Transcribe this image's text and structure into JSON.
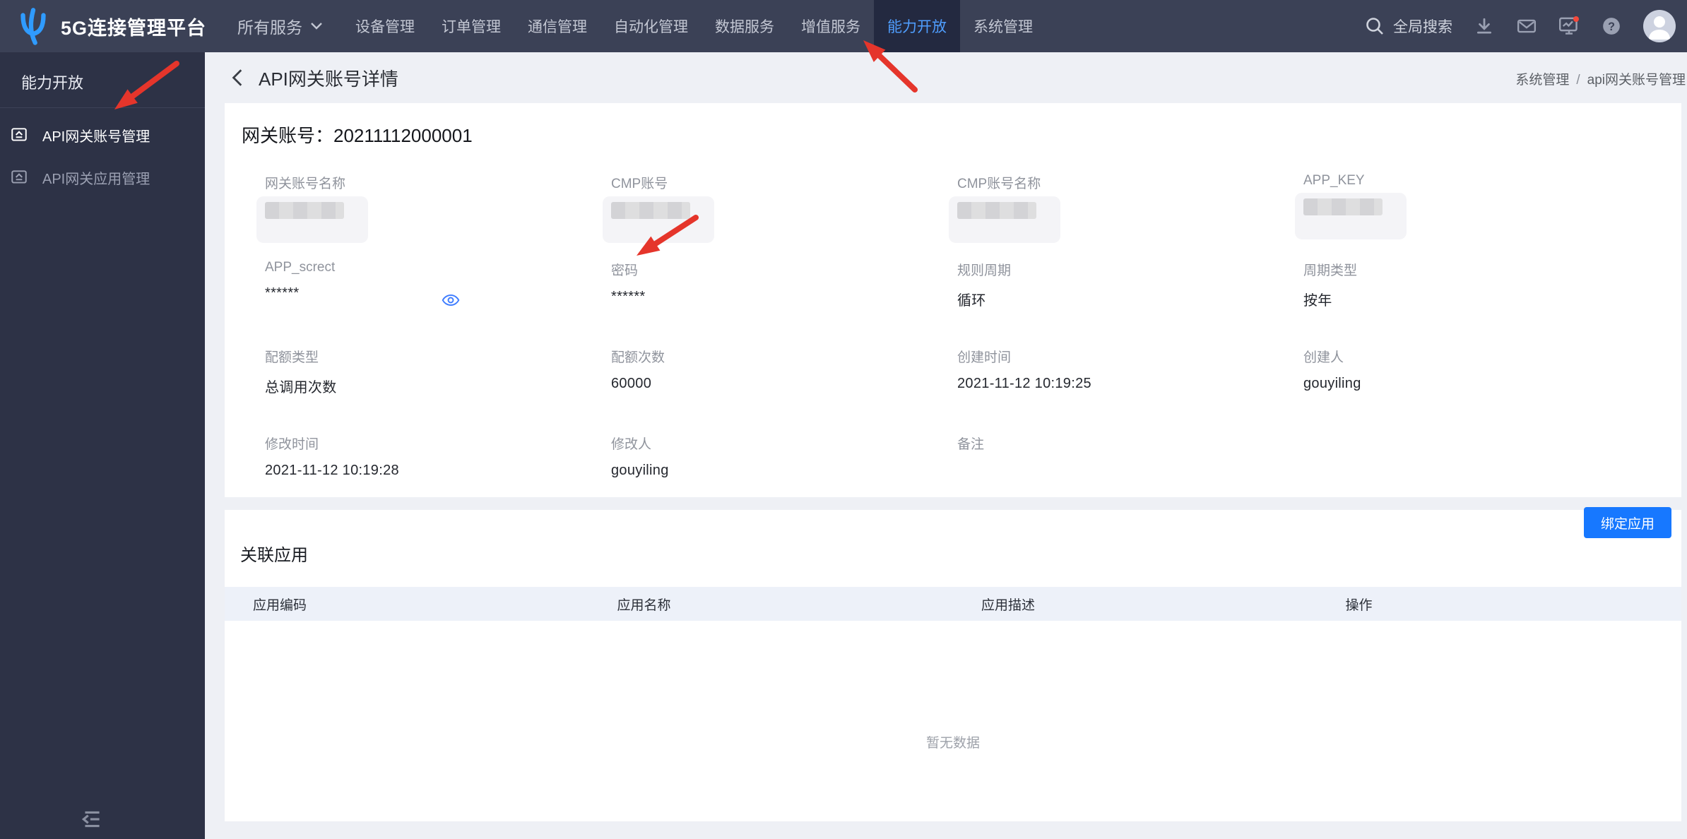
{
  "navbar": {
    "brand": "5G连接管理平台",
    "services_menu_label": "所有服务",
    "items": [
      "设备管理",
      "订单管理",
      "通信管理",
      "自动化管理",
      "数据服务",
      "增值服务",
      "能力开放",
      "系统管理"
    ],
    "active_index": 6,
    "search_label": "全局搜索",
    "right_icons": [
      "search-icon",
      "download-icon",
      "mail-icon",
      "monitor-icon",
      "help-icon",
      "user-avatar"
    ],
    "monitor_badge": true
  },
  "sidebar": {
    "title": "能力开放",
    "items": [
      {
        "label": "API网关账号管理",
        "active": true
      },
      {
        "label": "API网关应用管理",
        "active": false
      }
    ]
  },
  "page_header": {
    "title": "API网关账号详情",
    "breadcrumb": [
      "系统管理",
      "api网关账号管理"
    ],
    "breadcrumb_separator": "/"
  },
  "detail_card": {
    "title_label": "网关账号：",
    "account_id": "20211112000001",
    "fields": [
      {
        "label": "网关账号名称",
        "value": "",
        "redacted": true
      },
      {
        "label": "CMP账号",
        "value": "",
        "redacted": true
      },
      {
        "label": "CMP账号名称",
        "value": "",
        "redacted": true
      },
      {
        "label": "APP_KEY",
        "value": "",
        "redacted": true
      },
      {
        "label": "APP_screct",
        "value": "******",
        "eye": true
      },
      {
        "label": "密码",
        "value": "******"
      },
      {
        "label": "规则周期",
        "value": "循环"
      },
      {
        "label": "周期类型",
        "value": "按年"
      },
      {
        "label": "配额类型",
        "value": "总调用次数"
      },
      {
        "label": "配额次数",
        "value": "60000"
      },
      {
        "label": "创建时间",
        "value": "2021-11-12 10:19:25"
      },
      {
        "label": "创建人",
        "value": "gouyiling"
      },
      {
        "label": "修改时间",
        "value": "2021-11-12 10:19:28"
      },
      {
        "label": "修改人",
        "value": "gouyiling"
      },
      {
        "label": "备注",
        "value": ""
      }
    ]
  },
  "related_apps": {
    "title": "关联应用",
    "bind_button_label": "绑定应用",
    "columns": [
      "应用编码",
      "应用名称",
      "应用描述",
      "操作"
    ],
    "empty_text": "暂无数据"
  },
  "colors": {
    "accent_blue": "#1778ff",
    "nav_active_text": "#4f9eff",
    "annotation_red": "#e5352b",
    "navbar_bg": "#3b4156",
    "sidebar_bg": "#2d3246",
    "page_bg": "#eef0f5",
    "table_header_bg": "#edf1f9"
  }
}
